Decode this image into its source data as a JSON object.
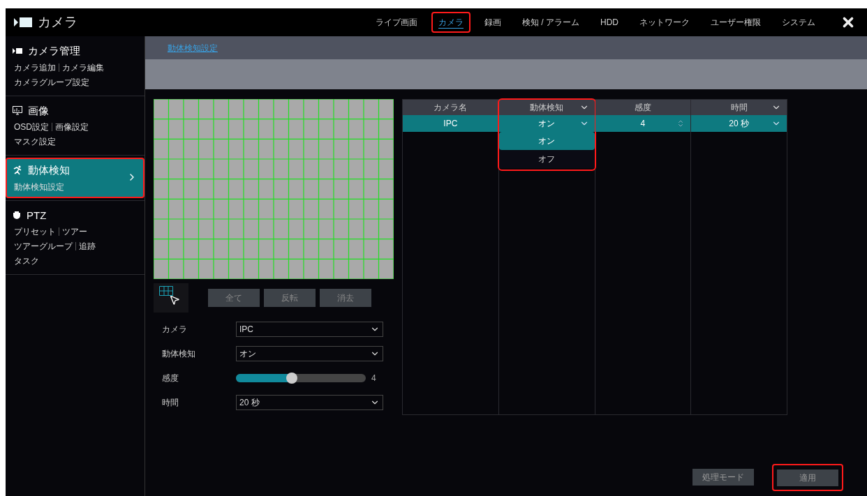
{
  "app_title": "カメラ",
  "nav_tabs": [
    {
      "label": "ライブ画面",
      "selected": false,
      "highlighted": false
    },
    {
      "label": "カメラ",
      "selected": true,
      "highlighted": true
    },
    {
      "label": "録画",
      "selected": false,
      "highlighted": false
    },
    {
      "label": "検知 / アラーム",
      "selected": false,
      "highlighted": false
    },
    {
      "label": "HDD",
      "selected": false,
      "highlighted": false
    },
    {
      "label": "ネットワーク",
      "selected": false,
      "highlighted": false
    },
    {
      "label": "ユーザー権限",
      "selected": false,
      "highlighted": false
    },
    {
      "label": "システム",
      "selected": false,
      "highlighted": false
    }
  ],
  "sidebar": [
    {
      "kind": "camera",
      "title": "カメラ管理",
      "selected": false,
      "highlighted": false,
      "link_rows": [
        [
          "カメラ追加",
          "カメラ編集"
        ],
        [
          "カメラグループ設定"
        ]
      ]
    },
    {
      "kind": "image",
      "title": "画像",
      "selected": false,
      "highlighted": false,
      "link_rows": [
        [
          "OSD設定",
          "画像設定"
        ],
        [
          "マスク設定"
        ]
      ]
    },
    {
      "kind": "motion",
      "title": "動体検知",
      "selected": true,
      "highlighted": true,
      "link_rows": [
        [
          "動体検知設定"
        ]
      ]
    },
    {
      "kind": "ptz",
      "title": "PTZ",
      "selected": false,
      "highlighted": false,
      "link_rows": [
        [
          "プリセット",
          "ツアー"
        ],
        [
          "ツアーグループ",
          "追跡"
        ],
        [
          "タスク"
        ]
      ]
    }
  ],
  "breadcrumb": "動体検知設定",
  "area_buttons": [
    "全て",
    "反転",
    "消去"
  ],
  "form": [
    {
      "kind": "select",
      "label": "カメラ",
      "value": "IPC"
    },
    {
      "kind": "select",
      "label": "動体検知",
      "value": "オン"
    },
    {
      "kind": "slider",
      "label": "感度",
      "level": 0.43,
      "reading": "4"
    },
    {
      "kind": "select",
      "label": "時間",
      "value": "20 秒"
    }
  ],
  "table": {
    "columns": [
      {
        "label": "カメラ名",
        "kind": "text",
        "dropdown": false,
        "highlighted": false
      },
      {
        "label": "動体検知",
        "kind": "select",
        "dropdown": true,
        "highlighted": true,
        "menu": [
          {
            "label": "オン",
            "selected": true
          },
          {
            "label": "オフ",
            "selected": false
          }
        ]
      },
      {
        "label": "感度",
        "kind": "spinner",
        "dropdown": false,
        "highlighted": false
      },
      {
        "label": "時間",
        "kind": "select",
        "dropdown": true,
        "highlighted": false
      }
    ],
    "rows": [
      {
        "selected": true,
        "cells": [
          "IPC",
          "オン",
          "4",
          "20 秒"
        ]
      }
    ]
  },
  "footer_buttons": [
    {
      "label": "処理モード",
      "highlighted": false
    },
    {
      "label": "適用",
      "highlighted": true
    }
  ]
}
